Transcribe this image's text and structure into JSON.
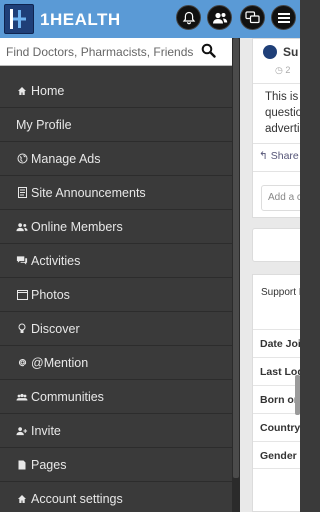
{
  "app": {
    "brand": "1HEALTH"
  },
  "topbar": {
    "icons": [
      "bell-icon",
      "friends-icon",
      "chat-icon",
      "menu-icon"
    ]
  },
  "search": {
    "placeholder": "Find Doctors, Pharmacists, Friends"
  },
  "sidebar": {
    "items": [
      {
        "label": "Home",
        "icon": "home-icon"
      },
      {
        "label": "My Profile",
        "icon": ""
      },
      {
        "label": "Manage Ads",
        "icon": "globe-icon"
      },
      {
        "label": "Site Announcements",
        "icon": "document-icon"
      },
      {
        "label": "Online Members",
        "icon": "users-icon"
      },
      {
        "label": "Activities",
        "icon": "comments-icon"
      },
      {
        "label": "Photos",
        "icon": "photo-icon"
      },
      {
        "label": "Discover",
        "icon": "lightbulb-icon"
      },
      {
        "label": "@Mention",
        "icon": "at-icon"
      },
      {
        "label": "Communities",
        "icon": "community-icon"
      },
      {
        "label": "Invite",
        "icon": "user-plus-icon"
      },
      {
        "label": "Pages",
        "icon": "page-icon"
      },
      {
        "label": "Account settings",
        "icon": "home-icon"
      }
    ]
  },
  "feed": {
    "post": {
      "author": "Su",
      "clock": "2",
      "text_lines": [
        "This is",
        "question",
        "advertis"
      ],
      "share": "Share",
      "comment_placeholder": "Add a c"
    },
    "info": {
      "header": "Support I",
      "rows": [
        "Date Joi",
        "Last Log",
        "Born on:",
        "Country",
        "Gender"
      ]
    }
  },
  "colors": {
    "topbar": "#5a9ad6",
    "sidebar": "#3a3a3a",
    "logo": "#1f3f78"
  }
}
